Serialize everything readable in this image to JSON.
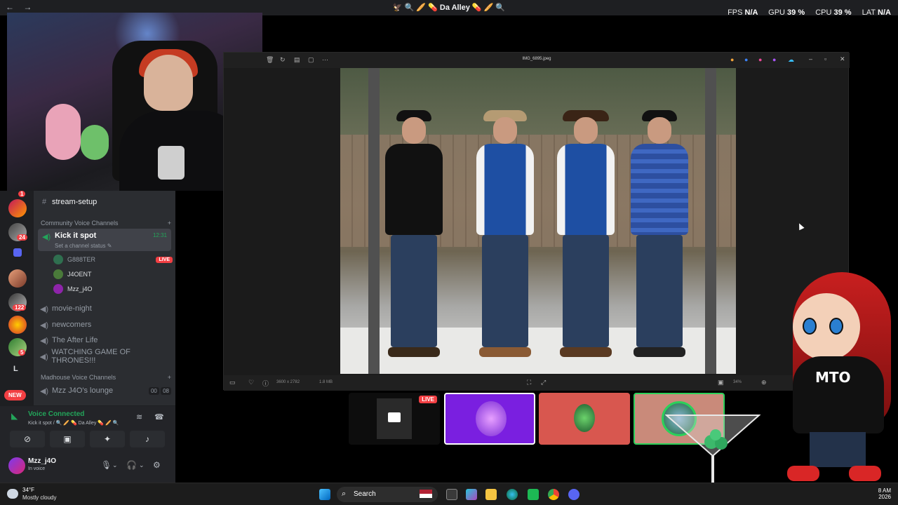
{
  "titlebar": {
    "title": "🦅 🔍 🥖 💊 Da Alley 💊 🥖 🔍"
  },
  "overlay_stats": {
    "fps_label": "FPS",
    "fps_value": "N/A",
    "gpu_label": "GPU",
    "gpu_value": "39 %",
    "cpu_label": "CPU",
    "cpu_value": "39 %",
    "lat_label": "LAT",
    "lat_value": "N/A"
  },
  "servers": {
    "badges": [
      "1",
      "24",
      "122",
      "5"
    ],
    "letter": "L",
    "new_label": "NEW"
  },
  "channels": {
    "stream_setup": "stream-setup",
    "community_category": "Community Voice Channels",
    "active_channel": "Kick it spot",
    "active_status": "Set a channel status ✎",
    "active_time": "12:31",
    "users": [
      {
        "name": "G888TER",
        "live": "LIVE"
      },
      {
        "name": "J4OENT"
      },
      {
        "name": "Mzz_j4O"
      }
    ],
    "voice_list": [
      "movie-night",
      "newcomers",
      "The After Life",
      "WATCHING GAME OF THRONES!!!"
    ],
    "madhouse_category": "Madhouse Voice Channels",
    "madhouse_channel": "Mzz J4O's lounge",
    "madhouse_counts": [
      "00",
      "08"
    ]
  },
  "voice_panel": {
    "title": "Voice Connected",
    "sub": "Kick it spot / 🔍 🥖 💊 Da Alley 💊 🥖 🔍"
  },
  "user_panel": {
    "name": "Mzz_j4O",
    "status": "In voice"
  },
  "photo_viewer": {
    "filename": "IMG_6895.jpeg",
    "dimensions": "3600 x 2782",
    "filesize": "1.8 MB",
    "zoom": "34%"
  },
  "thumbnails": {
    "live_label": "LIVE"
  },
  "mascot": {
    "tag": "MTO"
  },
  "taskbar": {
    "temp": "34°F",
    "condition": "Mostly cloudy",
    "search_label": "Search",
    "time": "8 AM",
    "date": "2026"
  },
  "colors": {
    "discord_green": "#23a55a",
    "discord_red": "#f23f43",
    "channel_bg": "#2b2d31",
    "server_bg": "#1e1f22"
  }
}
